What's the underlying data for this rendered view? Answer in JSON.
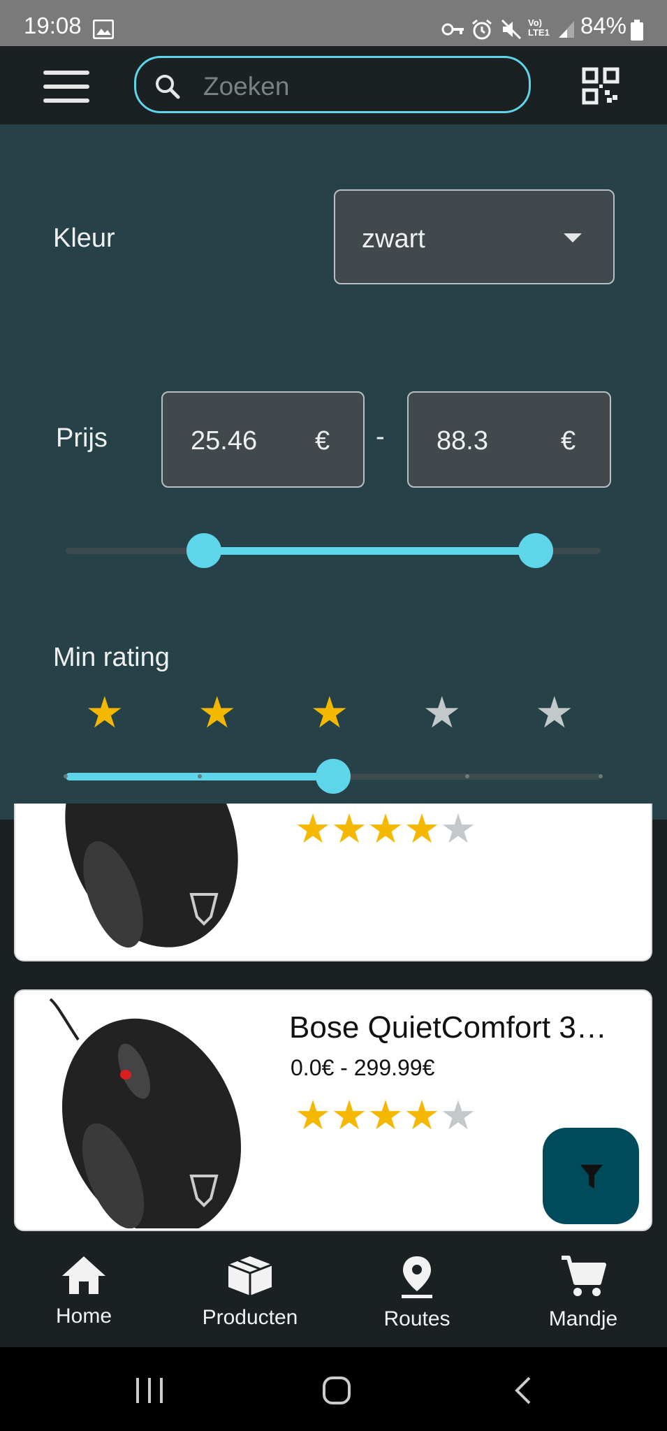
{
  "status_bar": {
    "time": "19:08",
    "battery": "84%"
  },
  "search": {
    "placeholder": "Zoeken"
  },
  "filter": {
    "color_label": "Kleur",
    "color_value": "zwart",
    "price_label": "Prijs",
    "price_min": "25.46",
    "price_max": "88.3",
    "currency": "€",
    "separator": "-",
    "min_rating_label": "Min rating",
    "min_rating_value": 3,
    "rating_max": 5
  },
  "products": [
    {
      "rating": 4
    },
    {
      "title": "Bose QuietComfort 3…",
      "price_range": "0.0€ - 299.99€",
      "rating": 4
    }
  ],
  "bottom_nav": [
    {
      "label": "Home",
      "icon": "home-icon"
    },
    {
      "label": "Producten",
      "icon": "box-icon"
    },
    {
      "label": "Routes",
      "icon": "location-pin-icon"
    },
    {
      "label": "Mandje",
      "icon": "cart-icon"
    }
  ],
  "colors": {
    "accent": "#5ed5e9",
    "panel": "#264147",
    "star_on": "#f5b800",
    "star_off": "#c3c8cb",
    "fab": "#004b5b"
  }
}
